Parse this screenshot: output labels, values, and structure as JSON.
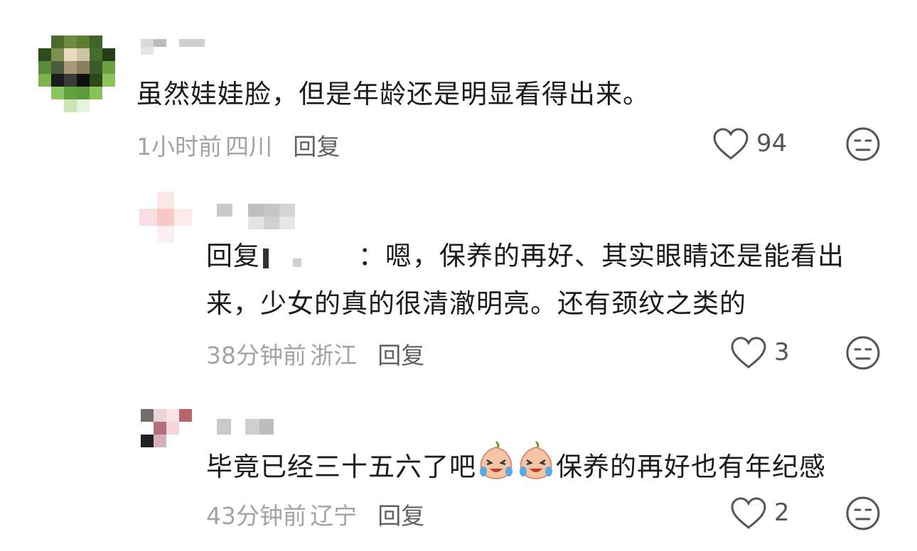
{
  "comments": [
    {
      "text": "虽然娃娃脸，但是年龄还是明显看得出来。",
      "time": "1小时前",
      "location": "四川",
      "reply_label": "回复",
      "likes": "94"
    },
    {
      "reply_prefix": "回复",
      "text_after_name": "：嗯，保养的再好、其实眼睛还是能看出",
      "text_line2": "来，少女的真的很清澈明亮。还有颈纹之类的",
      "time": "38分钟前",
      "location": "浙江",
      "reply_label": "回复",
      "likes": "3"
    },
    {
      "text_before_emoji": "毕竟已经三十五六了吧",
      "emojis": [
        "crying-laughing-emoji",
        "crying-laughing-emoji"
      ],
      "text_after_emoji": "保养的再好也有年纪感",
      "time": "43分钟前",
      "location": "辽宁",
      "reply_label": "回复",
      "likes": "2"
    }
  ],
  "icons": [
    "heart-icon",
    "dislike-face-icon"
  ],
  "colors": {
    "meta_text": "#a3a3a3",
    "reply_link": "#5f5f5f",
    "main_text": "#1b1b1b"
  }
}
